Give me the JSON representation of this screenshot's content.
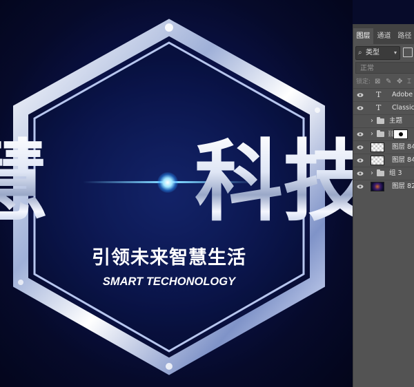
{
  "canvas": {
    "title_left": "慧",
    "title_right": "科技",
    "subtitle": "引领未来智慧生活",
    "subtitle_en": "SMART TECHONOLOGY",
    "colors": {
      "background": "#0b1450",
      "frame": "#dfe8ff",
      "glow": "#7fd6ff"
    }
  },
  "layers_panel": {
    "tabs": [
      {
        "label": "图层",
        "active": true
      },
      {
        "label": "通道",
        "active": false
      },
      {
        "label": "路径",
        "active": false
      }
    ],
    "filter": {
      "icon": "search-icon",
      "label": "类型"
    },
    "blend_mode": "正常",
    "lock_label": "锁定:",
    "lock_icons": [
      "lock-transparent-icon",
      "lock-paint-icon",
      "lock-move-icon",
      "lock-artboard-icon"
    ],
    "layers": [
      {
        "kind": "text",
        "name": "Adobe F"
      },
      {
        "kind": "text",
        "name": "Classic h"
      },
      {
        "kind": "group",
        "name": "主题"
      },
      {
        "kind": "group-mask",
        "name": ""
      },
      {
        "kind": "pixel",
        "name": "图层 84"
      },
      {
        "kind": "pixel",
        "name": "图层 84"
      },
      {
        "kind": "group",
        "name": "组 3"
      },
      {
        "kind": "pixel-space",
        "name": "图层 82"
      }
    ]
  }
}
